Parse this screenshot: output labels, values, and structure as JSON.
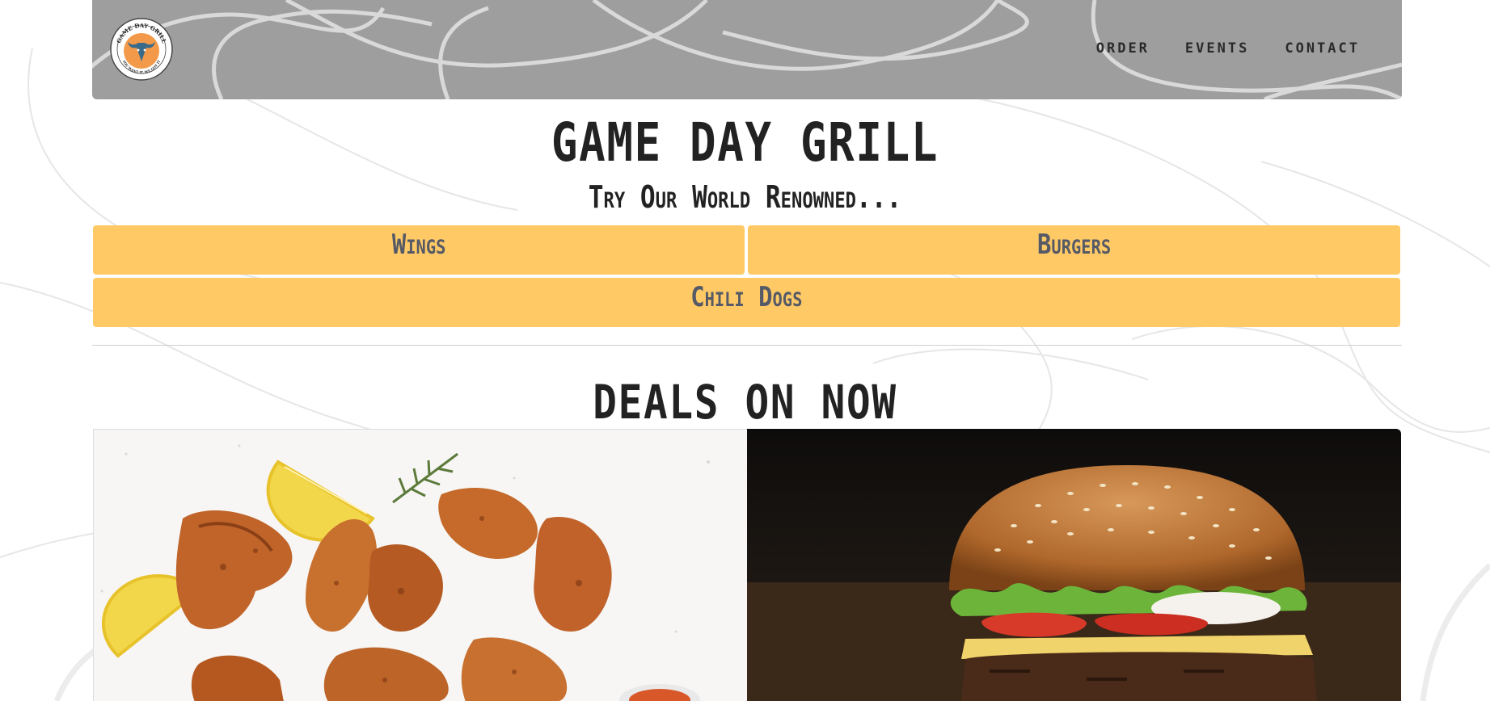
{
  "nav": {
    "logo": {
      "icon": "bull-head-icon",
      "ring_text": "GAME DAY GRILL",
      "bottom_text": "YOU WANT IT, WE GOT IT",
      "bg_color": "#f39a4a",
      "accent_color": "#3a6a8a"
    },
    "links": [
      "ORDER",
      "EVENTS",
      "CONTACT"
    ],
    "bg_color": "#9e9e9e"
  },
  "hero": {
    "title": "GAME DAY GRILL",
    "subtitle": "Try Our World Renowned..."
  },
  "menu": {
    "items": [
      "Wings",
      "Burgers",
      "Chili Dogs"
    ],
    "button_color": "#ffc966"
  },
  "deals": {
    "title": "DEALS ON NOW",
    "images": [
      {
        "name": "wings-image",
        "subject": "chicken wings with lemon wedges"
      },
      {
        "name": "burger-image",
        "subject": "cheeseburger with lettuce, tomato and onion"
      }
    ]
  }
}
